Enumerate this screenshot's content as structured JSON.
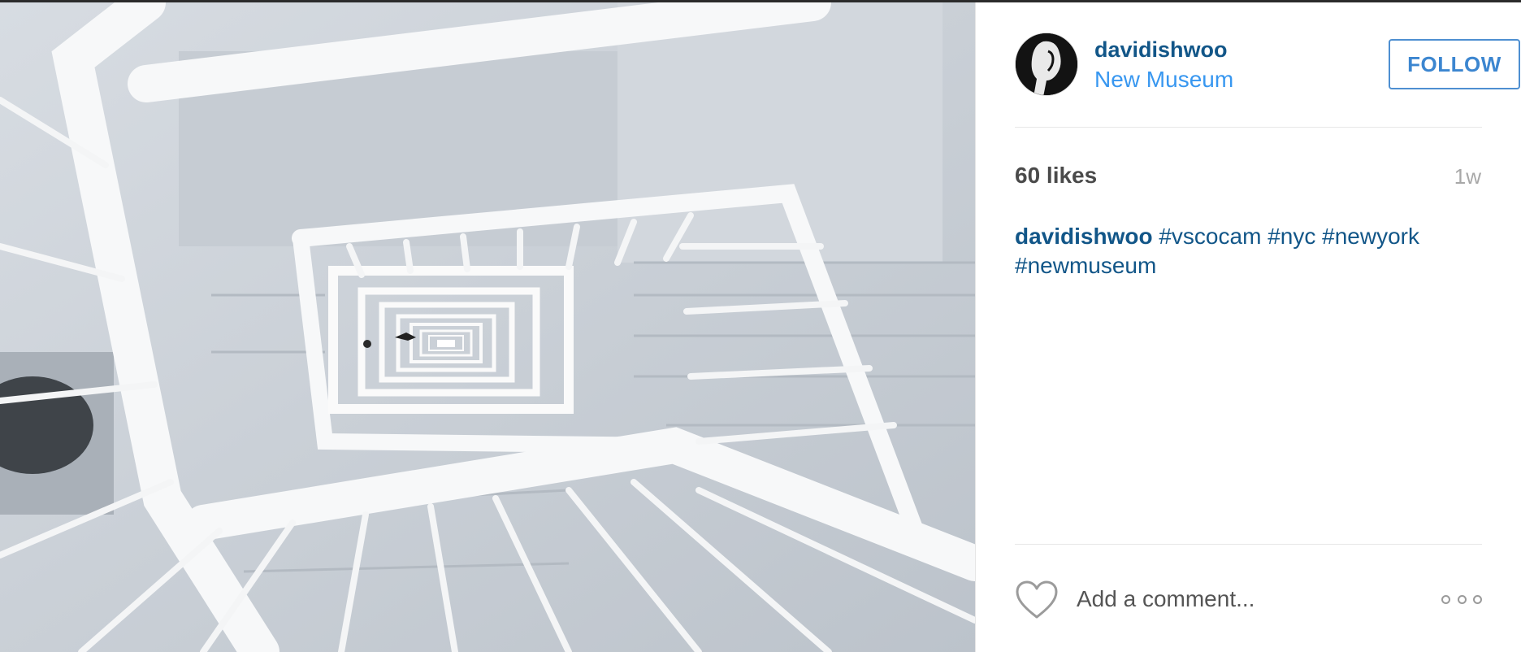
{
  "post": {
    "image_alt": "Looking down a white spiral stairwell",
    "header": {
      "username": "davidishwoo",
      "location": "New Museum",
      "follow_label": "FOLLOW"
    },
    "stats": {
      "likes": "60 likes",
      "age": "1w"
    },
    "caption": {
      "username": "davidishwoo",
      "hashtags": [
        "#vscocam",
        "#nyc",
        "#newyork",
        "#newmuseum"
      ]
    },
    "comment": {
      "placeholder": "Add a comment..."
    },
    "icons": {
      "like": "heart-outline-icon",
      "more": "ellipsis-icon"
    }
  },
  "colors": {
    "link": "#125688",
    "accent": "#3897f0",
    "muted": "#a8a8a8"
  }
}
